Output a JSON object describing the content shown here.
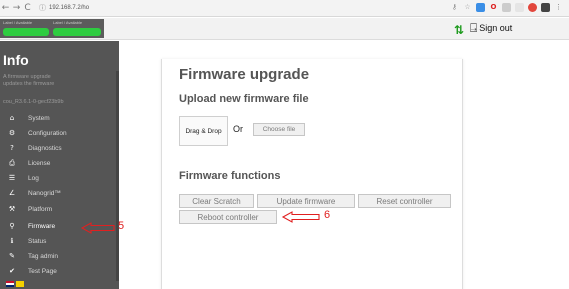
{
  "browser": {
    "back_glyph": "←",
    "forward_glyph": "→",
    "reload_glyph": "C",
    "lock_glyph": "ⓘ",
    "url": "192.168.7.2/ho"
  },
  "header": {
    "status_labels": [
      "Label / Available",
      "Label / Available"
    ],
    "status_color": "#2ecc40",
    "sync_icon": "⇅",
    "door_icon": "⍈",
    "signout_label": "Sign out"
  },
  "sidebar": {
    "title": "Info",
    "subtitle_lines": [
      "A firmware upgrade",
      "updates the firmware"
    ],
    "version": "cou_R3.6.1-0-gecf23b9b",
    "items": [
      {
        "icon": "⌂",
        "label": "System"
      },
      {
        "icon": "⚙",
        "label": "Configuration"
      },
      {
        "icon": "?",
        "label": "Diagnostics"
      },
      {
        "icon": "⎙",
        "label": "License"
      },
      {
        "icon": "☰",
        "label": "Log"
      },
      {
        "icon": "∠",
        "label": "Nanogrid™"
      },
      {
        "icon": "⚒",
        "label": "Platform"
      },
      {
        "icon": "⚲",
        "label": "Firmware"
      },
      {
        "icon": "ℹ",
        "label": "Status"
      },
      {
        "icon": "✎",
        "label": "Tag admin"
      },
      {
        "icon": "✔",
        "label": "Test Page"
      }
    ],
    "bg_color": "#555555"
  },
  "main": {
    "title": "Firmware upgrade",
    "upload_heading": "Upload new firmware file",
    "dropzone_label": "Drag & Drop",
    "or_label": "Or",
    "choose_file_label": "Choose file",
    "functions_heading": "Firmware functions",
    "buttons": {
      "clear_scratch": "Clear Scratch",
      "update_firmware": "Update firmware",
      "reset_controller": "Reset controller",
      "reboot_controller": "Reboot controller"
    }
  },
  "annotations": {
    "step_5": "5",
    "step_6": "6",
    "color": "#e02020"
  }
}
